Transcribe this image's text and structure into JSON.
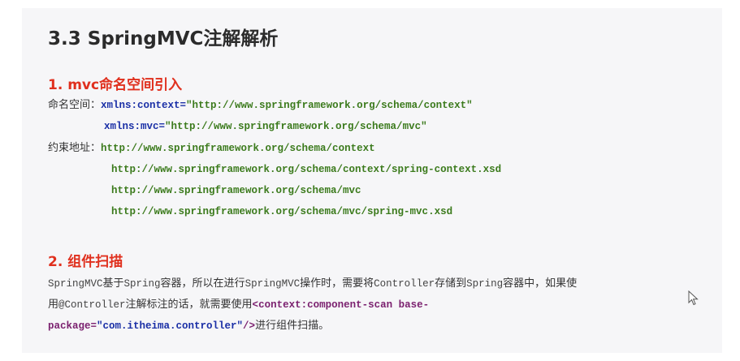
{
  "title": "3.3 SpringMVC注解解析",
  "section1": {
    "heading": "1. mvc命名空间引入",
    "namespace_label": "命名空间：",
    "ns_context_attr": "xmlns:context=",
    "ns_context_val": "\"http://www.springframework.org/schema/context\"",
    "ns_mvc_attr": "xmlns:mvc=",
    "ns_mvc_val": "\"http://www.springframework.org/schema/mvc\"",
    "constraint_label": "约束地址：",
    "constraints": [
      "http://www.springframework.org/schema/context",
      "http://www.springframework.org/schema/context/spring-context.xsd",
      "http://www.springframework.org/schema/mvc",
      "http://www.springframework.org/schema/mvc/spring-mvc.xsd"
    ]
  },
  "section2": {
    "heading": "2. 组件扫描",
    "p1_a": "SpringMVC",
    "p1_b": "基于",
    "p1_c": "Spring",
    "p1_d": "容器，所以在进行",
    "p1_e": "SpringMVC",
    "p1_f": "操作时，需要将",
    "p1_g": "Controller",
    "p1_h": "存储到",
    "p1_i": "Spring",
    "p1_j": "容器中，如果使",
    "p2_a": "用",
    "p2_b": "@Controller",
    "p2_c": "注解标注的话，就需要使用",
    "p2_d": "<",
    "p2_e": "context:component-scan base-",
    "p3_a": "package=",
    "p3_b": "\"com.itheima.controller\"",
    "p3_c": "/>",
    "p3_d": "进行组件扫描。"
  },
  "icons": {
    "cursor": "mouse-pointer-icon"
  }
}
